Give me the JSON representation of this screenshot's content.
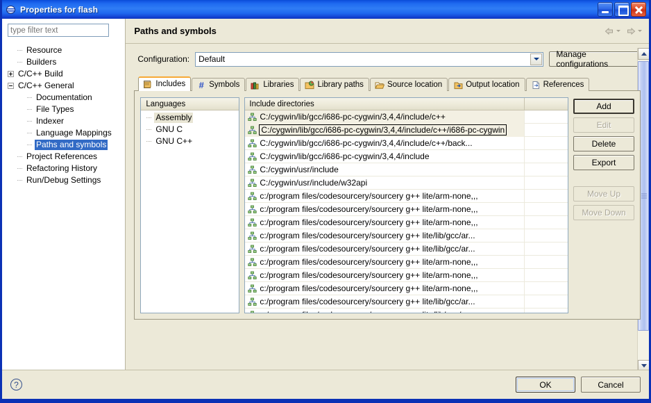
{
  "window": {
    "title": "Properties for flash",
    "app_icon": "eclipse-globe-icon",
    "minimize_label": "",
    "maximize_label": "",
    "close_label": ""
  },
  "filter": {
    "placeholder": "type filter text",
    "value": ""
  },
  "tree": {
    "items": [
      {
        "label": "Resource",
        "level": 1,
        "twisty": "none",
        "selected": false
      },
      {
        "label": "Builders",
        "level": 1,
        "twisty": "none",
        "selected": false
      },
      {
        "label": "C/C++ Build",
        "level": 0,
        "twisty": "plus",
        "selected": false
      },
      {
        "label": "C/C++ General",
        "level": 0,
        "twisty": "minus",
        "selected": false
      },
      {
        "label": "Documentation",
        "level": 2,
        "twisty": "none",
        "selected": false
      },
      {
        "label": "File Types",
        "level": 2,
        "twisty": "none",
        "selected": false
      },
      {
        "label": "Indexer",
        "level": 2,
        "twisty": "none",
        "selected": false
      },
      {
        "label": "Language Mappings",
        "level": 2,
        "twisty": "none",
        "selected": false
      },
      {
        "label": "Paths and symbols",
        "level": 2,
        "twisty": "none",
        "selected": true
      },
      {
        "label": "Project References",
        "level": 1,
        "twisty": "none",
        "selected": false
      },
      {
        "label": "Refactoring History",
        "level": 1,
        "twisty": "none",
        "selected": false
      },
      {
        "label": "Run/Debug Settings",
        "level": 1,
        "twisty": "none",
        "selected": false
      }
    ]
  },
  "header": {
    "title": "Paths and symbols",
    "back_icon": "back-arrow-icon",
    "forward_icon": "forward-arrow-icon"
  },
  "configuration": {
    "label": "Configuration:",
    "value": "Default",
    "manage_label": "Manage configurations"
  },
  "tabs": [
    {
      "label": "Includes",
      "icon": "includes-folder-icon",
      "active": true
    },
    {
      "label": "Symbols",
      "icon": "hash-icon",
      "active": false
    },
    {
      "label": "Libraries",
      "icon": "books-icon",
      "active": false
    },
    {
      "label": "Library paths",
      "icon": "library-paths-folder-icon",
      "active": false
    },
    {
      "label": "Source location",
      "icon": "open-folder-icon",
      "active": false
    },
    {
      "label": "Output location",
      "icon": "output-folder-icon",
      "active": false
    },
    {
      "label": "References",
      "icon": "references-page-icon",
      "active": false
    }
  ],
  "languages": {
    "header": "Languages",
    "items": [
      {
        "label": "Assembly",
        "selected": true
      },
      {
        "label": "GNU C",
        "selected": false
      },
      {
        "label": "GNU C++",
        "selected": false
      }
    ]
  },
  "include_directories": {
    "header": "Include directories",
    "rows": [
      {
        "path": "C:/cygwin/lib/gcc/i686-pc-cygwin/3,4,4/include/c++",
        "icon": "include-path-icon",
        "selected": true,
        "focused": false
      },
      {
        "path": "C:/cygwin/lib/gcc/i686-pc-cygwin/3,4,4/include/c++/i686-pc-cygwin",
        "icon": "include-path-icon",
        "selected": true,
        "focused": true
      },
      {
        "path": "C:/cygwin/lib/gcc/i686-pc-cygwin/3,4,4/include/c++/back...",
        "icon": "include-path-icon",
        "selected": false,
        "focused": false
      },
      {
        "path": "C:/cygwin/lib/gcc/i686-pc-cygwin/3,4,4/include",
        "icon": "include-path-icon",
        "selected": false,
        "focused": false
      },
      {
        "path": "C:/cygwin/usr/include",
        "icon": "include-path-icon",
        "selected": false,
        "focused": false
      },
      {
        "path": "C:/cygwin/usr/include/w32api",
        "icon": "include-path-icon",
        "selected": false,
        "focused": false
      },
      {
        "path": "c:/program files/codesourcery/sourcery g++ lite/arm-none,,,",
        "icon": "include-path-icon",
        "selected": false,
        "focused": false
      },
      {
        "path": "c:/program files/codesourcery/sourcery g++ lite/arm-none,,,",
        "icon": "include-path-icon",
        "selected": false,
        "focused": false
      },
      {
        "path": "c:/program files/codesourcery/sourcery g++ lite/arm-none,,,",
        "icon": "include-path-icon",
        "selected": false,
        "focused": false
      },
      {
        "path": "c:/program files/codesourcery/sourcery g++ lite/lib/gcc/ar...",
        "icon": "include-path-icon",
        "selected": false,
        "focused": false
      },
      {
        "path": "c:/program files/codesourcery/sourcery g++ lite/lib/gcc/ar...",
        "icon": "include-path-icon",
        "selected": false,
        "focused": false
      },
      {
        "path": "c:/program files/codesourcery/sourcery g++ lite/arm-none,,,",
        "icon": "include-path-icon",
        "selected": false,
        "focused": false
      },
      {
        "path": "c:/program files/codesourcery/sourcery g++ lite/arm-none,,,",
        "icon": "include-path-icon",
        "selected": false,
        "focused": false
      },
      {
        "path": "c:/program files/codesourcery/sourcery g++ lite/arm-none,,,",
        "icon": "include-path-icon",
        "selected": false,
        "focused": false
      },
      {
        "path": "c:/program files/codesourcery/sourcery g++ lite/lib/gcc/ar...",
        "icon": "include-path-icon",
        "selected": false,
        "focused": false
      },
      {
        "path": "c:/program files/codesourcery/sourcery g++ lite/lib/gcc/ar...",
        "icon": "include-path-icon",
        "selected": false,
        "focused": false
      }
    ]
  },
  "side_buttons": [
    {
      "label": "Add",
      "enabled": true,
      "default": true
    },
    {
      "label": "Edit",
      "enabled": false,
      "default": false
    },
    {
      "label": "Delete",
      "enabled": true,
      "default": false
    },
    {
      "label": "Export",
      "enabled": true,
      "default": false
    },
    {
      "label": "Move Up",
      "enabled": false,
      "default": false
    },
    {
      "label": "Move Down",
      "enabled": false,
      "default": false
    }
  ],
  "footer": {
    "help_icon": "help-question-icon",
    "ok_label": "OK",
    "cancel_label": "Cancel"
  },
  "colors": {
    "title_blue": "#0b31b5",
    "selection_blue": "#316ac5",
    "dialog_face": "#ece9d8",
    "active_tab_accent": "#f7a936",
    "scrollbar_thumb": "#aec0ef"
  }
}
